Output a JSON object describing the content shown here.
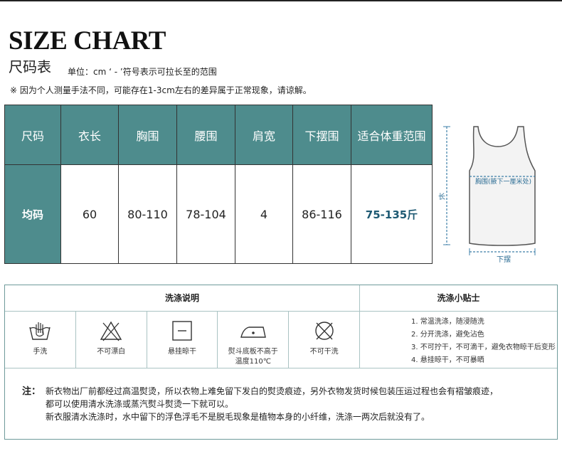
{
  "header": {
    "title": "SIZE CHART",
    "subtitle": "尺码表",
    "unit_note": "单位：cm  ‘ - ’符号表示可拉长至的范围",
    "disclaimer": "※ 因为个人测量手法不同，可能存在1-3cm左右的差异属于正常现象，请谅解。"
  },
  "size_table": {
    "headers": [
      "尺码",
      "衣长",
      "胸围",
      "腰围",
      "肩宽",
      "下摆围",
      "适合体重范围"
    ],
    "row": [
      "均码",
      "60",
      "80-110",
      "78-104",
      "4",
      "86-116",
      "75-135斤"
    ]
  },
  "diagram": {
    "chest_label": "胸围(腋下一厘米处)",
    "length_label": "长",
    "hem_label": "下摆"
  },
  "care": {
    "left_title": "洗涤说明",
    "right_title": "洗涤小贴士",
    "icons": [
      {
        "icon": "hand-wash-icon",
        "label": "手洗"
      },
      {
        "icon": "no-bleach-icon",
        "label": "不可漂白"
      },
      {
        "icon": "hang-dry-icon",
        "label": "悬挂晾干"
      },
      {
        "icon": "iron-low-icon",
        "label_line1": "熨斗底板不高于",
        "label_line2": "温度110℃"
      },
      {
        "icon": "no-dry-clean-icon",
        "label": "不可干洗"
      }
    ],
    "tips": [
      "1. 常温洗涤，随浸随洗",
      "2. 分开洗涤，避免沾色",
      "3. 不可拧干，不可滴干，避免衣物晾干后变形",
      "4. 悬挂晾干，不可暴晒"
    ],
    "note_lead": "注：",
    "note_lines": [
      "新衣物出厂前都经过高温熨烫，所以衣物上难免留下发白的熨烫痕迹，另外衣物发货时候包装压运过程也会有褶皱痕迹，",
      "都可以使用清水洗涤或蒸汽熨斗熨烫一下就可以。",
      "新衣服清水洗涤时，水中留下的浮色浮毛不是脱毛现象是植物本身的小纤维，洗涤一两次后就没有了。"
    ]
  }
}
